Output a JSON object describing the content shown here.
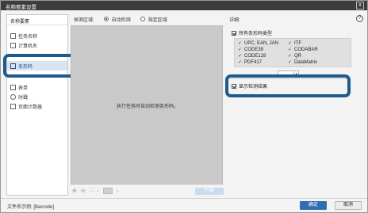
{
  "window": {
    "title": "名称要素设置",
    "close_glyph": "x"
  },
  "sidebar": {
    "header": "名称要素",
    "items": [
      {
        "label": "任务名称",
        "icon": "document-icon"
      },
      {
        "label": "计算机名",
        "icon": "computer-icon"
      },
      {
        "label": "条形码",
        "icon": "barcode-icon",
        "selected": true
      },
      {
        "label": "表单",
        "icon": "form-icon"
      },
      {
        "label": "时戳",
        "icon": "clock-icon"
      },
      {
        "label": "页面计数器",
        "icon": "counter-icon"
      }
    ]
  },
  "detect_area": {
    "label": "探测区域:",
    "options": [
      {
        "label": "自动检测",
        "selected": true
      },
      {
        "label": "指定区域",
        "selected": false
      }
    ]
  },
  "preview": {
    "message": "执行任务时自动检测条形码。",
    "scan_button": "扫描"
  },
  "detail": {
    "label": "详细:",
    "all_types_label": "所有条形码类型",
    "all_types_checked": true,
    "codes": [
      [
        "UPC, EAN, JAN",
        "ITF"
      ],
      [
        "CODE39",
        "CODABAR"
      ],
      [
        "CODE128",
        "QR"
      ],
      [
        "PDF417",
        "DataMatrix"
      ]
    ],
    "show_result_label": "显示检测结果",
    "show_result_checked": true
  },
  "footer": {
    "filename_example": "文件名示例: [Barcode]",
    "ok_label": "确定",
    "cancel_label": "取消"
  },
  "colors": {
    "highlight": "#1e5a8c",
    "primary_button": "#2f6fb0",
    "selected_item": "#d8e4f2",
    "preview_bg": "#c9c9c9"
  }
}
